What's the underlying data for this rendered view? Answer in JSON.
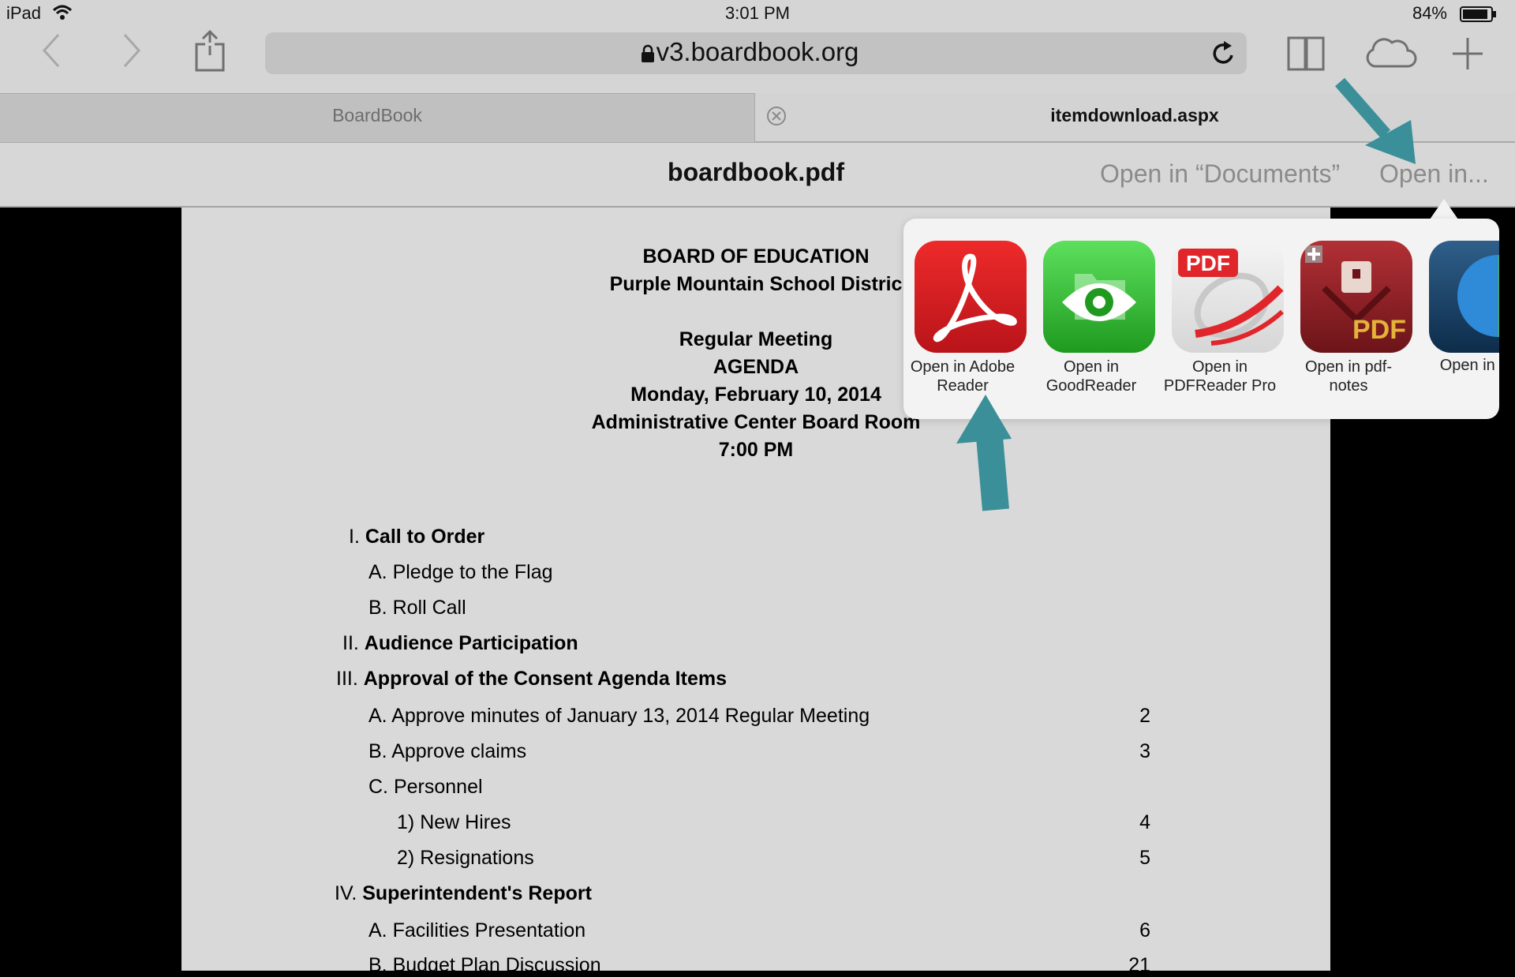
{
  "status": {
    "device": "iPad",
    "time": "3:01 PM",
    "battery": "84%"
  },
  "toolbar": {
    "url": "v3.boardbook.org"
  },
  "tabs": [
    {
      "label": "BoardBook"
    },
    {
      "label": "itemdownload.aspx"
    }
  ],
  "doc_header": {
    "title": "boardbook.pdf",
    "open_documents": "Open in “Documents”",
    "open_in": "Open in..."
  },
  "popover": {
    "apps": [
      {
        "label_l1": "Open in Adobe",
        "label_l2": "Reader",
        "icon": "adobe-reader-icon"
      },
      {
        "label_l1": "Open in",
        "label_l2": "GoodReader",
        "icon": "goodreader-icon"
      },
      {
        "label_l1": "Open in",
        "label_l2": "PDFReader Pro",
        "icon": "pdfreader-pro-icon",
        "badge": "PDF"
      },
      {
        "label_l1": "Open in pdf-",
        "label_l2": "notes",
        "icon": "pdf-notes-icon",
        "badge": "PDF"
      },
      {
        "label_l1": "Open in W",
        "label_l2": "",
        "icon": "globe-icon"
      }
    ]
  },
  "agenda": {
    "org1": "BOARD OF EDUCATION",
    "org2": "Purple Mountain School Distric",
    "meeting": "Regular Meeting",
    "agenda_label": "AGENDA",
    "date": "Monday, February 10, 2014",
    "location": "Administrative Center Board Room",
    "time": "7:00 PM",
    "items": [
      {
        "num": "I.",
        "text": "Call to Order",
        "page": ""
      },
      {
        "num": "A.",
        "text": "Pledge to the Flag",
        "page": ""
      },
      {
        "num": "B.",
        "text": "Roll Call",
        "page": ""
      },
      {
        "num": "II.",
        "text": "Audience Participation",
        "page": ""
      },
      {
        "num": "III.",
        "text": "Approval of the Consent Agenda Items",
        "page": ""
      },
      {
        "num": "A.",
        "text": "Approve minutes of January 13, 2014 Regular Meeting",
        "page": "2"
      },
      {
        "num": "B.",
        "text": "Approve claims",
        "page": "3"
      },
      {
        "num": "C.",
        "text": "Personnel",
        "page": ""
      },
      {
        "num": "1)",
        "text": "New Hires",
        "page": "4"
      },
      {
        "num": "2)",
        "text": "Resignations",
        "page": "5"
      },
      {
        "num": "IV.",
        "text": "Superintendent's Report",
        "page": ""
      },
      {
        "num": "A.",
        "text": "Facilities Presentation",
        "page": "6"
      },
      {
        "num": "B.",
        "text": "Budget Plan Discussion",
        "page": "21"
      }
    ]
  },
  "colors": {
    "annotation_arrow": "#3a8f99",
    "adobe_red": "#c8161b",
    "goodreader_green": "#2fb52f",
    "pdfnotes_maroon": "#8e1d22"
  }
}
